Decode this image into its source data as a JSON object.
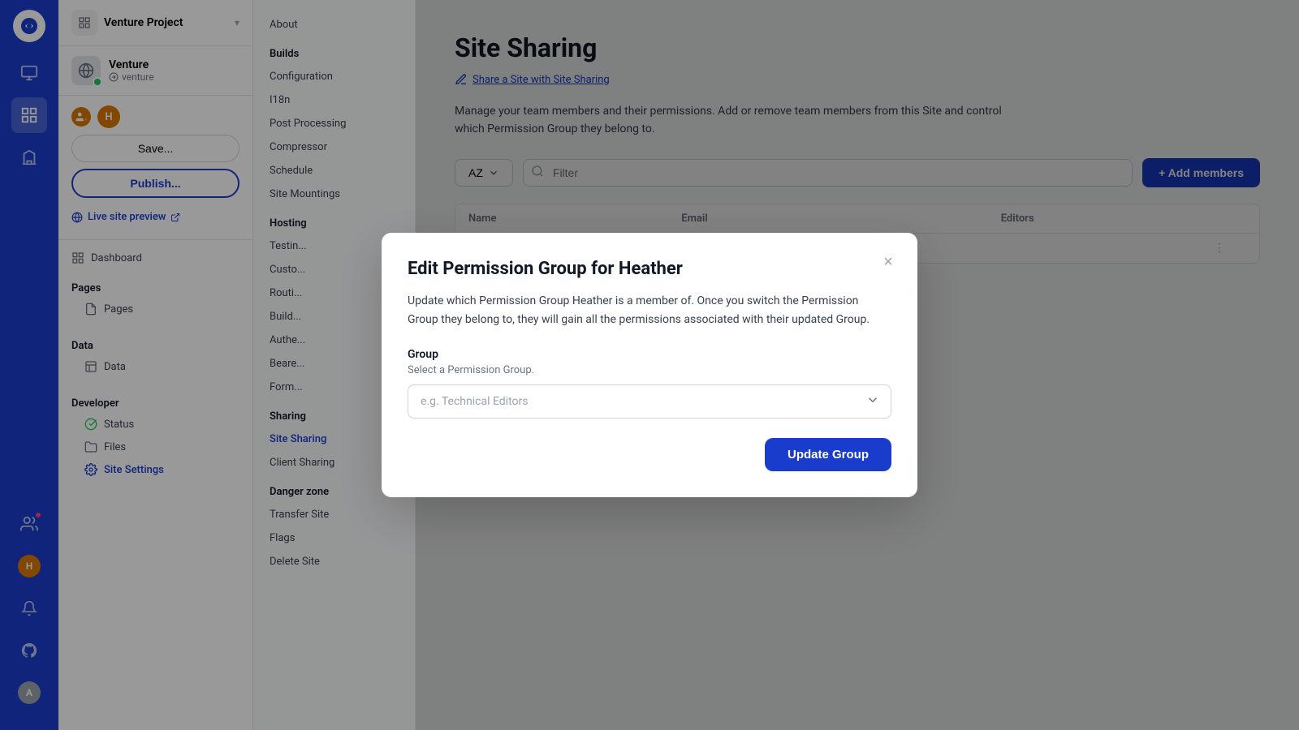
{
  "iconStrip": {
    "items": [
      {
        "name": "grid-icon",
        "symbol": "⊞",
        "active": true
      },
      {
        "name": "monitor-icon",
        "symbol": "🖥"
      },
      {
        "name": "apps-icon",
        "symbol": "⚏"
      },
      {
        "name": "building-icon",
        "symbol": "🏢"
      }
    ],
    "bottomItems": [
      {
        "name": "bell-icon",
        "symbol": "🔔"
      },
      {
        "name": "github-icon",
        "symbol": "⬡"
      },
      {
        "name": "avatar-icon",
        "symbol": "👤"
      }
    ]
  },
  "sidebar": {
    "projectName": "Venture Project",
    "siteIcon": "👁",
    "siteName": "Venture",
    "siteSlug": "venture",
    "saveLabel": "Save...",
    "publishLabel": "Publish...",
    "livePreviewLabel": "Live site preview",
    "sections": [
      {
        "title": "",
        "items": [
          {
            "name": "dashboard",
            "label": "Dashboard",
            "icon": "📊"
          }
        ]
      },
      {
        "title": "Pages",
        "items": [
          {
            "name": "pages",
            "label": "Pages",
            "icon": "📄"
          }
        ]
      },
      {
        "title": "Data",
        "items": [
          {
            "name": "data",
            "label": "Data",
            "icon": "📋"
          }
        ]
      },
      {
        "title": "Developer",
        "items": [
          {
            "name": "status",
            "label": "Status",
            "icon": "✅"
          },
          {
            "name": "files",
            "label": "Files",
            "icon": "⬡"
          },
          {
            "name": "site-settings",
            "label": "Site Settings",
            "icon": "⚙",
            "active": true
          }
        ]
      }
    ]
  },
  "settingsNav": {
    "sections": [
      {
        "title": "About",
        "items": []
      },
      {
        "title": "Builds",
        "items": [
          {
            "name": "configuration",
            "label": "Configuration"
          },
          {
            "name": "i18n",
            "label": "I18n"
          },
          {
            "name": "post-processing",
            "label": "Post Processing"
          },
          {
            "name": "compressor",
            "label": "Compressor"
          },
          {
            "name": "schedule",
            "label": "Schedule"
          },
          {
            "name": "site-mountings",
            "label": "Site Mountings"
          }
        ]
      },
      {
        "title": "Hosting",
        "items": [
          {
            "name": "testing",
            "label": "Testin..."
          },
          {
            "name": "custom",
            "label": "Custo..."
          },
          {
            "name": "routing",
            "label": "Routi..."
          },
          {
            "name": "build-hooks",
            "label": "Build..."
          },
          {
            "name": "authentication",
            "label": "Authe..."
          },
          {
            "name": "bearer",
            "label": "Beare..."
          },
          {
            "name": "forms",
            "label": "Form..."
          }
        ]
      },
      {
        "title": "Sharing",
        "items": [
          {
            "name": "site-sharing",
            "label": "Site Sharing",
            "active": true
          },
          {
            "name": "client-sharing",
            "label": "Client Sharing"
          }
        ]
      },
      {
        "title": "Danger zone",
        "items": [
          {
            "name": "transfer-site",
            "label": "Transfer Site"
          },
          {
            "name": "flags",
            "label": "Flags"
          },
          {
            "name": "delete-site",
            "label": "Delete Site"
          }
        ]
      }
    ]
  },
  "main": {
    "title": "Site Sharing",
    "docLinkLabel": "Share a Site with Site Sharing",
    "description": "Manage your team members and their permissions. Add or remove team members from this Site and control which Permission Group they belong to.",
    "sortLabel": "AZ",
    "filterPlaceholder": "Filter",
    "addMembersLabel": "+ Add members",
    "tableHeaders": {
      "name": "Name",
      "email": "Email",
      "group": "Editors",
      "actions": ""
    }
  },
  "modal": {
    "title": "Edit Permission Group for Heather",
    "description": "Update which Permission Group Heather is a member of. Once you switch the Permission Group they belong to, they will gain all the permissions associated with their updated Group.",
    "groupLabel": "Group",
    "groupSubLabel": "Select a Permission Group.",
    "groupPlaceholder": "e.g. Technical Editors",
    "updateButtonLabel": "Update Group",
    "closeLabel": "×"
  },
  "colors": {
    "primary": "#1a3ccc",
    "primaryHover": "#1530a8",
    "success": "#22c55e",
    "border": "#e5e7eb",
    "textPrimary": "#111827",
    "textSecondary": "#6b7280",
    "background": "#f9fafb"
  }
}
